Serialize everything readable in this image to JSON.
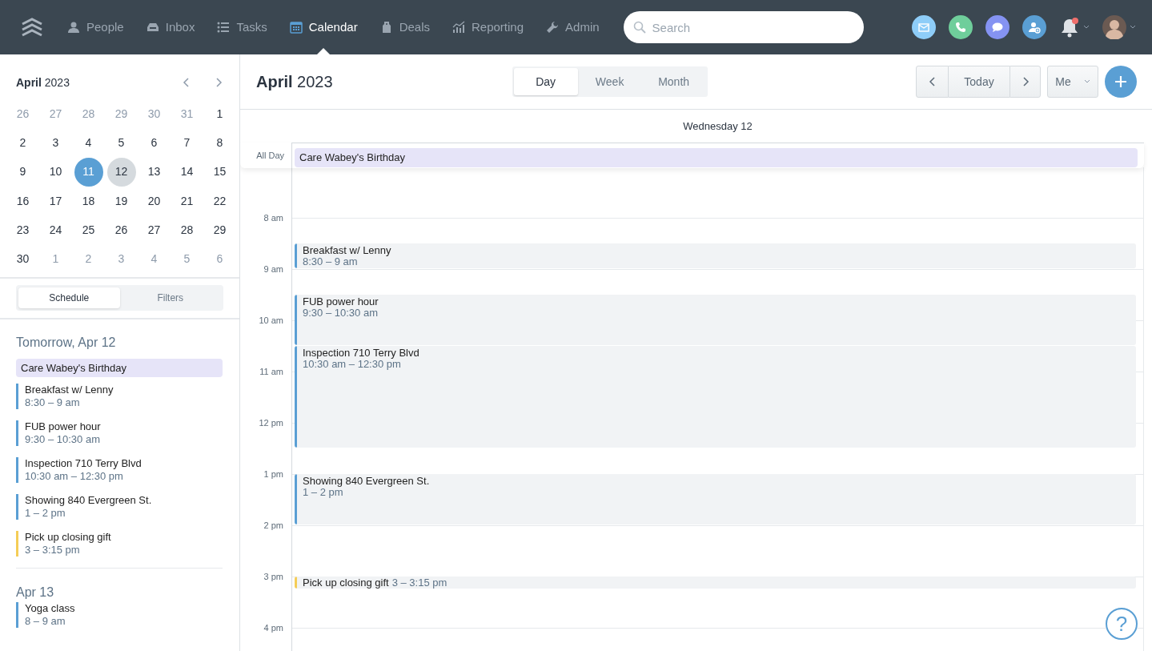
{
  "nav": {
    "items": [
      {
        "kind": "people",
        "label": "People",
        "selected": false
      },
      {
        "kind": "inbox",
        "label": "Inbox",
        "selected": false
      },
      {
        "kind": "tasks",
        "label": "Tasks",
        "selected": false
      },
      {
        "kind": "calendar",
        "label": "Calendar",
        "selected": true
      },
      {
        "kind": "deals",
        "label": "Deals",
        "selected": false
      },
      {
        "kind": "reporting",
        "label": "Reporting",
        "selected": false
      },
      {
        "kind": "admin",
        "label": "Admin",
        "selected": false
      }
    ],
    "search": {
      "placeholder": "Search"
    },
    "actions": [
      {
        "kind": "email",
        "color": "#8ecdf8"
      },
      {
        "kind": "phone",
        "color": "#6fce9b"
      },
      {
        "kind": "chat",
        "color": "#8593f2"
      },
      {
        "kind": "contact",
        "color": "#5a9fd4"
      }
    ],
    "notifications": {
      "unread": true
    }
  },
  "mini_calendar": {
    "title": "**April** 2023",
    "weeks": [
      [
        {
          "day": "26",
          "muted": true,
          "today": false,
          "selected": false
        },
        {
          "day": "27",
          "muted": true,
          "today": false,
          "selected": false
        },
        {
          "day": "28",
          "muted": true,
          "today": false,
          "selected": false
        },
        {
          "day": "29",
          "muted": true,
          "today": false,
          "selected": false
        },
        {
          "day": "30",
          "muted": true,
          "today": false,
          "selected": false
        },
        {
          "day": "31",
          "muted": true,
          "today": false,
          "selected": false
        },
        {
          "day": "1",
          "muted": false,
          "today": false,
          "selected": false
        }
      ],
      [
        {
          "day": "2",
          "muted": false,
          "today": false,
          "selected": false
        },
        {
          "day": "3",
          "muted": false,
          "today": false,
          "selected": false
        },
        {
          "day": "4",
          "muted": false,
          "today": false,
          "selected": false
        },
        {
          "day": "5",
          "muted": false,
          "today": false,
          "selected": false
        },
        {
          "day": "6",
          "muted": false,
          "today": false,
          "selected": false
        },
        {
          "day": "7",
          "muted": false,
          "today": false,
          "selected": false
        },
        {
          "day": "8",
          "muted": false,
          "today": false,
          "selected": false
        }
      ],
      [
        {
          "day": "9",
          "muted": false,
          "today": false,
          "selected": false
        },
        {
          "day": "10",
          "muted": false,
          "today": false,
          "selected": false
        },
        {
          "day": "11",
          "muted": false,
          "today": true,
          "selected": false
        },
        {
          "day": "12",
          "muted": false,
          "today": false,
          "selected": true
        },
        {
          "day": "13",
          "muted": false,
          "today": false,
          "selected": false
        },
        {
          "day": "14",
          "muted": false,
          "today": false,
          "selected": false
        },
        {
          "day": "15",
          "muted": false,
          "today": false,
          "selected": false
        }
      ],
      [
        {
          "day": "16",
          "muted": false,
          "today": false,
          "selected": false
        },
        {
          "day": "17",
          "muted": false,
          "today": false,
          "selected": false
        },
        {
          "day": "18",
          "muted": false,
          "today": false,
          "selected": false
        },
        {
          "day": "19",
          "muted": false,
          "today": false,
          "selected": false
        },
        {
          "day": "20",
          "muted": false,
          "today": false,
          "selected": false
        },
        {
          "day": "21",
          "muted": false,
          "today": false,
          "selected": false
        },
        {
          "day": "22",
          "muted": false,
          "today": false,
          "selected": false
        }
      ],
      [
        {
          "day": "23",
          "muted": false,
          "today": false,
          "selected": false
        },
        {
          "day": "24",
          "muted": false,
          "today": false,
          "selected": false
        },
        {
          "day": "25",
          "muted": false,
          "today": false,
          "selected": false
        },
        {
          "day": "26",
          "muted": false,
          "today": false,
          "selected": false
        },
        {
          "day": "27",
          "muted": false,
          "today": false,
          "selected": false
        },
        {
          "day": "28",
          "muted": false,
          "today": false,
          "selected": false
        },
        {
          "day": "29",
          "muted": false,
          "today": false,
          "selected": false
        }
      ],
      [
        {
          "day": "30",
          "muted": false,
          "today": false,
          "selected": false
        },
        {
          "day": "1",
          "muted": true,
          "today": false,
          "selected": false
        },
        {
          "day": "2",
          "muted": true,
          "today": false,
          "selected": false
        },
        {
          "day": "3",
          "muted": true,
          "today": false,
          "selected": false
        },
        {
          "day": "4",
          "muted": true,
          "today": false,
          "selected": false
        },
        {
          "day": "5",
          "muted": true,
          "today": false,
          "selected": false
        },
        {
          "day": "6",
          "muted": true,
          "today": false,
          "selected": false
        }
      ]
    ]
  },
  "sidebar_tabs": [
    {
      "label": "Schedule",
      "selected": true
    },
    {
      "label": "Filters",
      "selected": false
    }
  ],
  "schedule": [
    {
      "heading": "Tomorrow, Apr 12",
      "items": [
        {
          "kind": "allday",
          "title": "Care Wabey's Birthday",
          "color": "#e6e4f8"
        },
        {
          "kind": "timed",
          "title": "Breakfast w/ Lenny",
          "time": "8:30 – 9 am",
          "color": "#5a9fd4"
        },
        {
          "kind": "timed",
          "title": "FUB power hour",
          "time": "9:30 – 10:30 am",
          "color": "#5a9fd4"
        },
        {
          "kind": "timed",
          "title": "Inspection 710 Terry Blvd",
          "time": "10:30 am – 12:30 pm",
          "color": "#5a9fd4"
        },
        {
          "kind": "timed",
          "title": "Showing 840 Evergreen St.",
          "time": "1 – 2 pm",
          "color": "#5a9fd4"
        },
        {
          "kind": "timed",
          "title": "Pick up closing gift",
          "time": "3 – 3:15 pm",
          "color": "#f5cd57"
        }
      ]
    },
    {
      "heading": "Apr 13",
      "items": [
        {
          "kind": "timed",
          "title": "Yoga class",
          "time": "8 – 9 am",
          "color": "#5a9fd4"
        }
      ]
    }
  ],
  "header": {
    "title": "**April** 2023",
    "views": [
      {
        "label": "Day",
        "selected": true
      },
      {
        "label": "Week",
        "selected": false
      },
      {
        "label": "Month",
        "selected": false
      }
    ],
    "today": "Today",
    "owner": "Me"
  },
  "day_view": {
    "day": "Wednesday 12",
    "all_day_label": "All Day",
    "all_day": [
      {
        "title": "Care Wabey's Birthday",
        "color": "#e6e4f8"
      }
    ],
    "hours": [
      "8 am",
      "9 am",
      "10 am",
      "11 am",
      "12 pm",
      "1 pm",
      "2 pm",
      "3 pm",
      "4 pm"
    ],
    "events": [
      {
        "title": "Breakfast w/ Lenny",
        "time": "8:30 – 9 am",
        "color": "#5a9fd4"
      },
      {
        "title": "FUB power hour",
        "time": "9:30 – 10:30 am",
        "color": "#5a9fd4"
      },
      {
        "title": "Inspection 710 Terry Blvd",
        "time": "10:30 am – 12:30 pm",
        "color": "#5a9fd4"
      },
      {
        "title": "Showing 840 Evergreen St.",
        "time": "1 – 2 pm",
        "color": "#5a9fd4"
      },
      {
        "title": "Pick up closing gift",
        "time": "3 – 3:15 pm",
        "color": "#f5cd57"
      }
    ]
  },
  "help": "?"
}
